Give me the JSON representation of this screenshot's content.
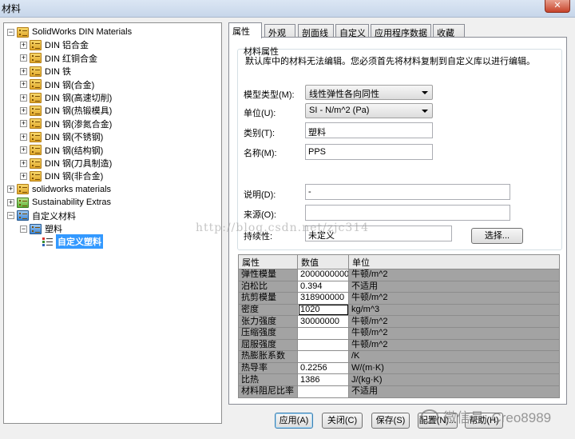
{
  "window": {
    "title": "材料"
  },
  "tree": {
    "items": [
      {
        "label": "SolidWorks DIN Materials",
        "depth": 0,
        "icon": "folder-yellow",
        "expander": "−"
      },
      {
        "label": "DIN 铝合金",
        "depth": 1,
        "icon": "folder-yellow",
        "expander": "+"
      },
      {
        "label": "DIN 红铜合金",
        "depth": 1,
        "icon": "folder-yellow",
        "expander": "+"
      },
      {
        "label": "DIN 铁",
        "depth": 1,
        "icon": "folder-yellow",
        "expander": "+"
      },
      {
        "label": "DIN 钢(合金)",
        "depth": 1,
        "icon": "folder-yellow",
        "expander": "+"
      },
      {
        "label": "DIN 钢(高速切削)",
        "depth": 1,
        "icon": "folder-yellow",
        "expander": "+"
      },
      {
        "label": "DIN 钢(热锻模具)",
        "depth": 1,
        "icon": "folder-yellow",
        "expander": "+"
      },
      {
        "label": "DIN 钢(渗氮合金)",
        "depth": 1,
        "icon": "folder-yellow",
        "expander": "+"
      },
      {
        "label": "DIN 钢(不锈钢)",
        "depth": 1,
        "icon": "folder-yellow",
        "expander": "+"
      },
      {
        "label": "DIN 钢(结构钢)",
        "depth": 1,
        "icon": "folder-yellow",
        "expander": "+"
      },
      {
        "label": "DIN 钢(刀具制造)",
        "depth": 1,
        "icon": "folder-yellow",
        "expander": "+"
      },
      {
        "label": "DIN 钢(非合金)",
        "depth": 1,
        "icon": "folder-yellow",
        "expander": "+"
      },
      {
        "label": "solidworks materials",
        "depth": 0,
        "icon": "folder-yellow",
        "expander": "+"
      },
      {
        "label": "Sustainability Extras",
        "depth": 0,
        "icon": "folder-green",
        "expander": "+"
      },
      {
        "label": "自定义材料",
        "depth": 0,
        "icon": "folder-blue",
        "expander": "−"
      },
      {
        "label": "塑料",
        "depth": 1,
        "icon": "folder-blue",
        "expander": "−"
      },
      {
        "label": "自定义塑料",
        "depth": 2,
        "icon": "material",
        "expander": "",
        "selected": true
      }
    ]
  },
  "tabs": [
    {
      "label": "属性",
      "active": true
    },
    {
      "label": "外观"
    },
    {
      "label": "剖面线"
    },
    {
      "label": "自定义"
    },
    {
      "label": "应用程序数据"
    },
    {
      "label": "收藏"
    }
  ],
  "properties": {
    "group_title": "材料属性",
    "group_desc": "默认库中的材料无法编辑。您必须首先将材料复制到自定义库以进行编辑。",
    "model_type_label": "模型类型(M):",
    "model_type_value": "线性弹性各向同性",
    "units_label": "单位(U):",
    "units_value": "SI - N/m^2 (Pa)",
    "category_label": "类别(T):",
    "category_value": "塑料",
    "name_label": "名称(M):",
    "name_value": "PPS",
    "description_label": "说明(D):",
    "description_value": "-",
    "source_label": "来源(O):",
    "source_value": "",
    "sustainability_label": "持续性:",
    "sustainability_value": "未定义",
    "select_button": "选择..."
  },
  "table": {
    "headers": [
      "属性",
      "数值",
      "单位"
    ],
    "rows": [
      {
        "name": "弹性模量",
        "value": "2000000000",
        "unit": "牛顿/m^2"
      },
      {
        "name": "泊松比",
        "value": "0.394",
        "unit": "不适用"
      },
      {
        "name": "抗剪模量",
        "value": "318900000",
        "unit": "牛顿/m^2"
      },
      {
        "name": "密度",
        "value": "1020",
        "unit": "kg/m^3",
        "focused": true
      },
      {
        "name": "张力强度",
        "value": "30000000",
        "unit": "牛顿/m^2"
      },
      {
        "name": "压缩强度",
        "value": "",
        "unit": "牛顿/m^2"
      },
      {
        "name": "屈服强度",
        "value": "",
        "unit": "牛顿/m^2"
      },
      {
        "name": "热膨胀系数",
        "value": "",
        "unit": "/K"
      },
      {
        "name": "热导率",
        "value": "0.2256",
        "unit": "W/(m·K)"
      },
      {
        "name": "比热",
        "value": "1386",
        "unit": "J/(kg·K)"
      },
      {
        "name": "材料阻尼比率",
        "value": "",
        "unit": "不适用"
      }
    ]
  },
  "buttons": {
    "apply": "应用(A)",
    "close": "关闭(C)",
    "save": "保存(S)",
    "config": "配置(N)...",
    "help": "帮助(H)"
  },
  "overlay": {
    "watermark": "http://blog.csdn.net/zjc314",
    "wechat": "微信号: Creo8989"
  }
}
